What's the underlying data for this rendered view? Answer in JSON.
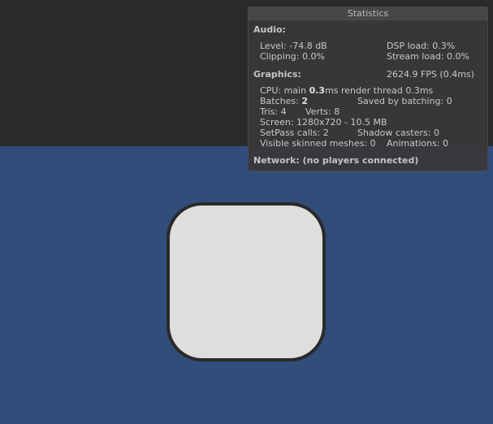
{
  "stats": {
    "title": "Statistics",
    "audio": {
      "header": "Audio:",
      "level": "Level: -74.8 dB",
      "dsp_load": "DSP load: 0.3%",
      "clipping": "Clipping: 0.0%",
      "stream_load": "Stream load: 0.0%"
    },
    "graphics": {
      "header": "Graphics:",
      "fps": "2624.9 FPS (0.4ms)",
      "cpu_prefix": "CPU: main ",
      "cpu_main": "0.3",
      "cpu_suffix": "ms  render thread 0.3ms",
      "batches_prefix": "Batches: ",
      "batches": "2",
      "saved_by_batching": "Saved by batching: 0",
      "tris": "Tris: 4",
      "verts": "Verts: 8",
      "screen": "Screen: 1280x720 - 10.5 MB",
      "setpass": "SetPass calls: 2",
      "shadow_casters": "Shadow casters: 0",
      "visible_skinned": "Visible skinned meshes: 0",
      "animations": "Animations: 0"
    },
    "network": "Network: (no players connected)"
  },
  "colors": {
    "viewport_top": "#2a2a2a",
    "viewport_bottom": "#314d79",
    "shape_fill": "#dedede"
  }
}
